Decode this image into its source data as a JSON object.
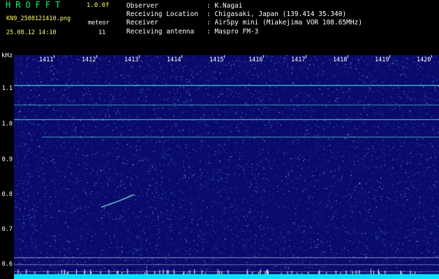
{
  "header": {
    "app_title": "HROFFT",
    "version": "1.0.0f",
    "filename": "KN9_2508121410.png",
    "meteor_label": "meteor",
    "datetime": "25.08.12 14:10",
    "meteor_count": "11"
  },
  "info": [
    {
      "label": "Observer",
      "value": ": K.Nagai"
    },
    {
      "label": "Receiving Location",
      "value": ": Chigasaki, Japan (139.414 35.340)"
    },
    {
      "label": "Receiver",
      "value": ": AirSpy mini (Miakejima VOR 108.65MHz)"
    },
    {
      "label": "Receiving antenna",
      "value": ": Maspro FM-3"
    }
  ],
  "spectrogram": {
    "y_unit": "kHz",
    "y_ticks": [
      "1.1",
      "1.0",
      "0.9",
      "0.8",
      "0.7",
      "0.6"
    ],
    "time_labels": [
      "1411",
      "1412",
      "1413",
      "1414",
      "1415",
      "1416",
      "1417",
      "1418",
      "1419",
      "1420"
    ],
    "background_color": "#0a0a6a",
    "trace_color": "#66ffff",
    "baseline_color": "#00e5ff"
  }
}
